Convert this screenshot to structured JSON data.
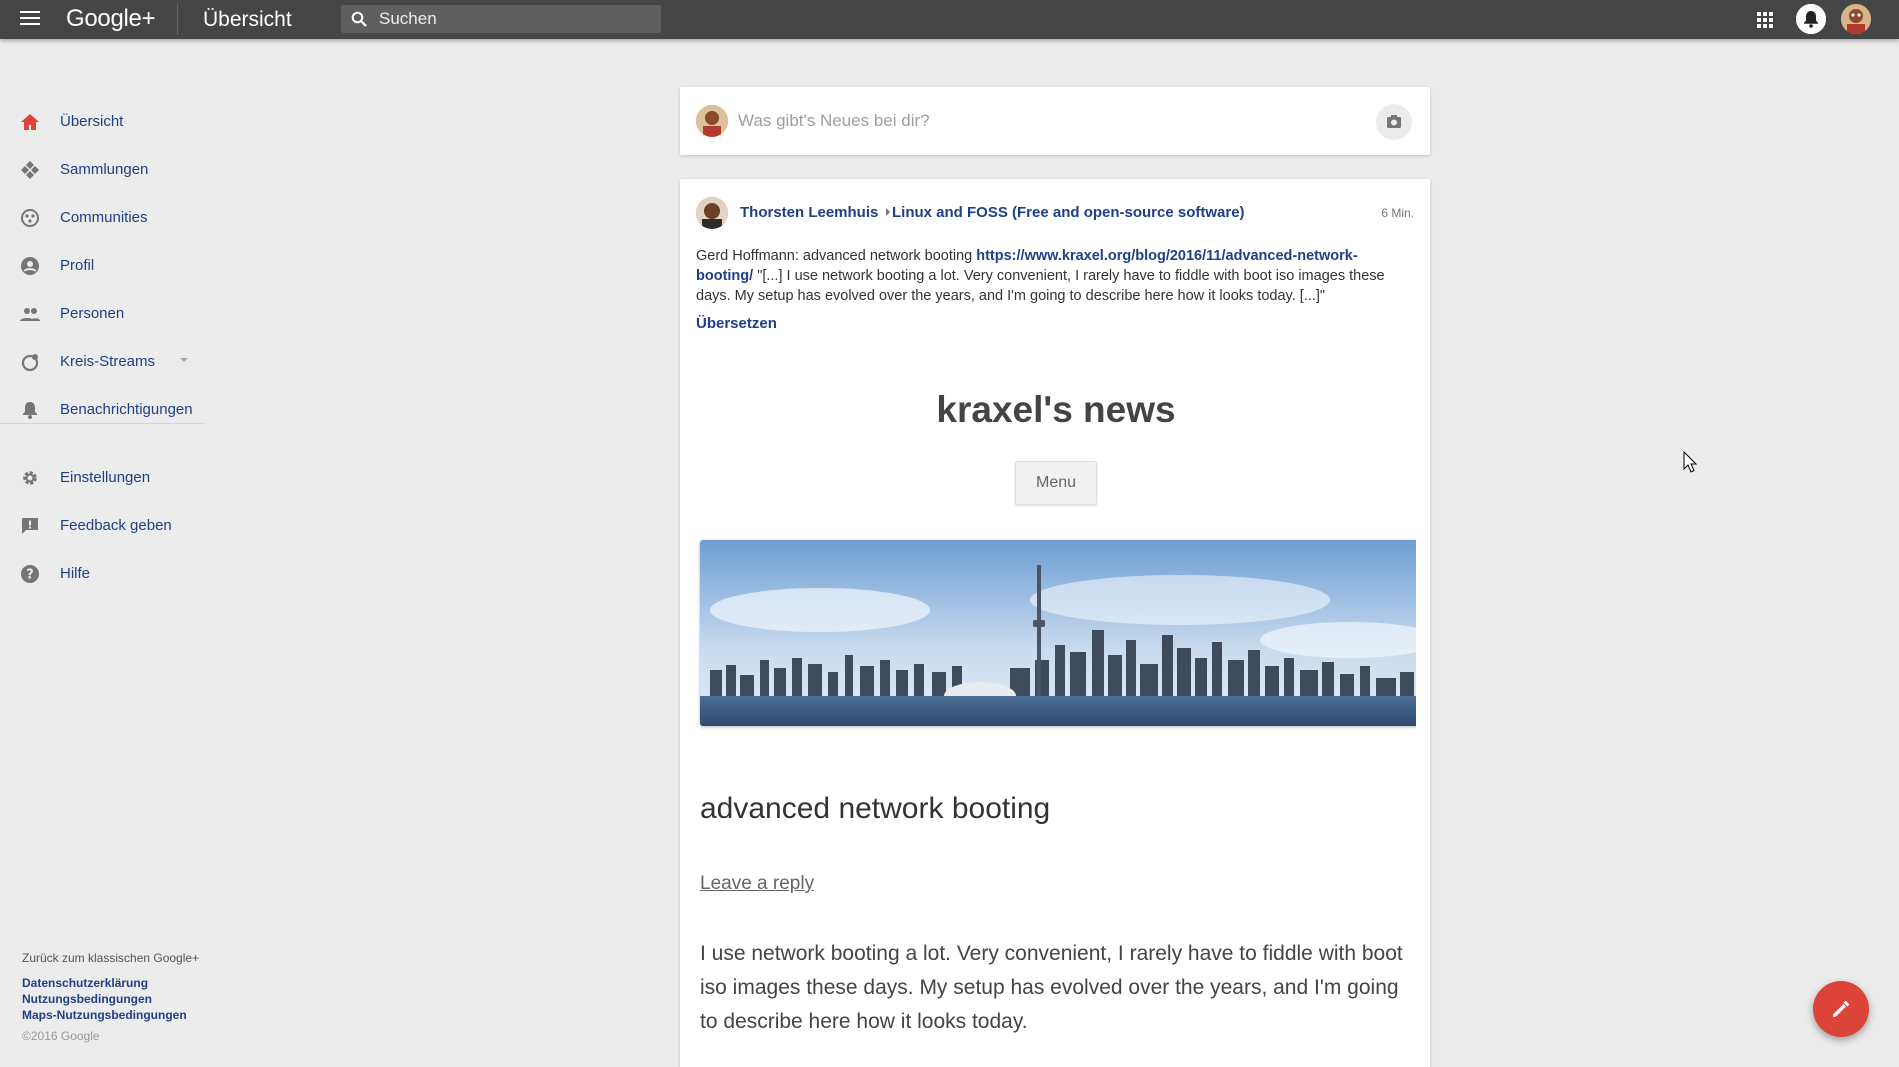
{
  "topbar": {
    "logo": "Google+",
    "page_title": "Übersicht",
    "search_placeholder": "Suchen"
  },
  "sidebar": {
    "items": [
      {
        "label": "Übersicht",
        "icon": "home-icon",
        "active": true
      },
      {
        "label": "Sammlungen",
        "icon": "collections-icon"
      },
      {
        "label": "Communities",
        "icon": "communities-icon"
      },
      {
        "label": "Profil",
        "icon": "profile-icon"
      },
      {
        "label": "Personen",
        "icon": "people-icon"
      },
      {
        "label": "Kreis-Streams",
        "icon": "circles-icon"
      },
      {
        "label": "Benachrichtigungen",
        "icon": "bell-icon"
      },
      {
        "label": "Einstellungen",
        "icon": "gear-icon"
      },
      {
        "label": "Feedback geben",
        "icon": "feedback-icon"
      },
      {
        "label": "Hilfe",
        "icon": "help-icon"
      }
    ],
    "footer": {
      "back": "Zurück zum klassischen Google+",
      "links": [
        "Datenschutzerklärung",
        "Nutzungsbedingungen",
        "Maps-Nutzungsbedingungen"
      ],
      "copyright": "©2016 Google"
    }
  },
  "composer": {
    "placeholder": "Was gibt's Neues bei dir?"
  },
  "post": {
    "author": "Thorsten Leemhuis",
    "community": "Linux and FOSS (Free and open-source software)",
    "time": "6 Min.",
    "text_prefix": "Gerd Hoffmann: advanced network booting ",
    "link": "https://www.kraxel.org/blog/2016/11/advanced-network-booting/",
    "text_suffix": " \"[...] I use network booting a lot. Very convenient, I rarely have to fiddle with boot iso images these days. My setup has evolved over the years, and I'm going to describe here how it looks today. [...]\"",
    "translate": "Übersetzen",
    "preview": {
      "site_title": "kraxel's news",
      "menu": "Menu",
      "article_title": "advanced network booting",
      "reply": "Leave a reply",
      "excerpt": "I use network booting a lot. Very convenient, I rarely have to fiddle with boot iso images these days. My setup has evolved over the years, and I'm going to describe here how it looks today."
    }
  },
  "colors": {
    "topbar": "#454545",
    "link": "#1f3f86",
    "accent_red": "#db4437",
    "background": "#ececec"
  }
}
